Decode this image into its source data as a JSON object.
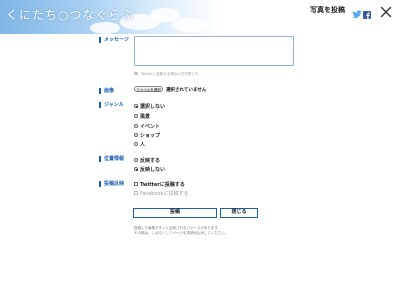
{
  "header": {
    "logo_text": "くにたち○つなぐらぶ",
    "page_title": "写真を投稿"
  },
  "message": {
    "label": "メッセージ",
    "value": "",
    "note": "Twitterに投稿する場合の文字数です。"
  },
  "image": {
    "label": "画像",
    "file_button": "ファイルを選択",
    "file_status": "選択されていません"
  },
  "genre": {
    "label": "ジャンル",
    "options": [
      {
        "label": "選択しない",
        "selected": true
      },
      {
        "label": "風景",
        "selected": false
      },
      {
        "label": "イベント",
        "selected": false
      },
      {
        "label": "ショップ",
        "selected": false
      },
      {
        "label": "人",
        "selected": false
      }
    ]
  },
  "location": {
    "label": "位置情報",
    "options": [
      {
        "label": "反映する",
        "selected": false
      },
      {
        "label": "反映しない",
        "selected": true
      }
    ]
  },
  "post_reflect": {
    "label": "投稿反映",
    "options": [
      {
        "label": "Twitterに投稿する",
        "checked": false,
        "enabled": true
      },
      {
        "label": "Facebookに投稿する",
        "checked": false,
        "enabled": false
      }
    ]
  },
  "actions": {
    "post": "投稿",
    "close": "閉じる"
  },
  "footer": {
    "line1": "投稿した画像がすぐに反映されないケースがあります。",
    "line2": "その際は、しばらくしてページを再読み込みしてください。"
  },
  "icons": {
    "twitter": "twitter-icon",
    "facebook": "facebook-icon",
    "close": "close-icon"
  },
  "colors": {
    "accent": "#1a5fb4",
    "twitter": "#55acee",
    "facebook": "#3b5998"
  }
}
